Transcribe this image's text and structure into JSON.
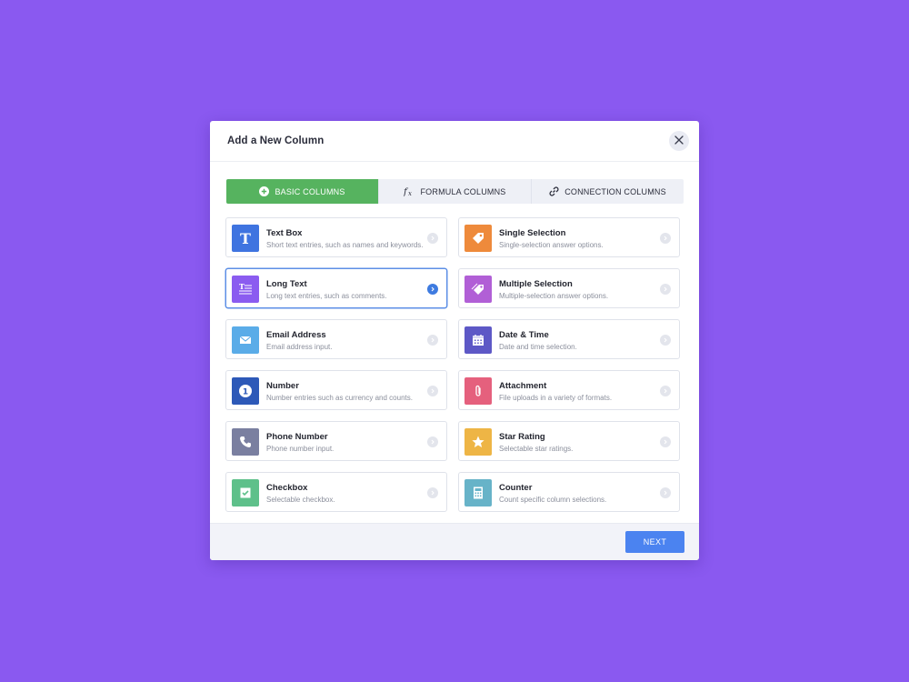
{
  "modal": {
    "title": "Add a New Column"
  },
  "tabs": [
    {
      "label": "BASIC COLUMNS",
      "icon": "plus-circle-icon"
    },
    {
      "label": "FORMULA COLUMNS",
      "icon": "fx-icon"
    },
    {
      "label": "CONNECTION COLUMNS",
      "icon": "link-icon"
    }
  ],
  "active_tab": 0,
  "columns": [
    {
      "title": "Text Box",
      "desc": "Short text entries, such as names and keywords.",
      "icon": "text-icon",
      "color": "#3f74e0"
    },
    {
      "title": "Single Selection",
      "desc": "Single-selection answer options.",
      "icon": "tag-icon",
      "color": "#ee8a3b"
    },
    {
      "title": "Long Text",
      "desc": "Long text entries, such as comments.",
      "icon": "long-text-icon",
      "color": "#8b5cf0"
    },
    {
      "title": "Multiple Selection",
      "desc": "Multiple-selection answer options.",
      "icon": "tags-icon",
      "color": "#b15fd6"
    },
    {
      "title": "Email Address",
      "desc": "Email address input.",
      "icon": "envelope-icon",
      "color": "#5aace8"
    },
    {
      "title": "Date & Time",
      "desc": "Date and time selection.",
      "icon": "calendar-icon",
      "color": "#5d58c6"
    },
    {
      "title": "Number",
      "desc": "Number entries such as currency and counts.",
      "icon": "number-icon",
      "color": "#2d59b8"
    },
    {
      "title": "Attachment",
      "desc": "File uploads in a variety of formats.",
      "icon": "paperclip-icon",
      "color": "#e5607d"
    },
    {
      "title": "Phone Number",
      "desc": "Phone number input.",
      "icon": "phone-icon",
      "color": "#7a7fa0"
    },
    {
      "title": "Star Rating",
      "desc": "Selectable star ratings.",
      "icon": "star-icon",
      "color": "#eeb545"
    },
    {
      "title": "Checkbox",
      "desc": "Selectable checkbox.",
      "icon": "checkbox-icon",
      "color": "#5ec08a"
    },
    {
      "title": "Counter",
      "desc": "Count specific column selections.",
      "icon": "calculator-icon",
      "color": "#67b3c8"
    }
  ],
  "selected_column": 2,
  "footer": {
    "next_label": "NEXT"
  },
  "colors": {
    "background": "#8a59f0",
    "active_tab": "#56b35f",
    "primary_button": "#4b83f0",
    "selected_border": "#5d8fe6"
  }
}
